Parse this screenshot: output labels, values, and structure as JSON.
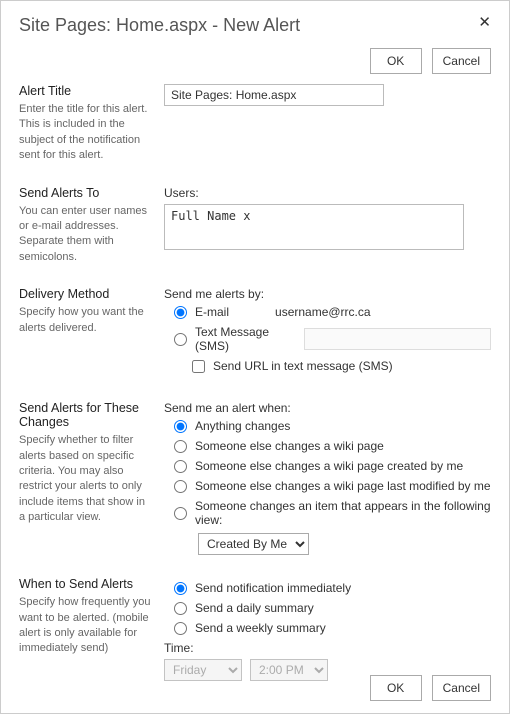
{
  "dialog": {
    "title": "Site Pages: Home.aspx - New Alert",
    "close": "✕"
  },
  "buttons": {
    "ok": "OK",
    "cancel": "Cancel"
  },
  "alertTitle": {
    "heading": "Alert Title",
    "desc": "Enter the title for this alert. This is included in the subject of the notification sent for this alert.",
    "value": "Site Pages: Home.aspx"
  },
  "sendTo": {
    "heading": "Send Alerts To",
    "desc": "You can enter user names or e-mail addresses. Separate them with semicolons.",
    "label": "Users:",
    "value": "Full Name x"
  },
  "delivery": {
    "heading": "Delivery Method",
    "desc": "Specify how you want the alerts delivered.",
    "label": "Send me alerts by:",
    "emailOpt": "E-mail",
    "emailValue": "username@rrc.ca",
    "smsOpt": "Text Message (SMS)",
    "smsUrl": "Send URL in text message (SMS)"
  },
  "changes": {
    "heading": "Send Alerts for These Changes",
    "desc": "Specify whether to filter alerts based on specific criteria. You may also restrict your alerts to only include items that show in a particular view.",
    "label": "Send me an alert when:",
    "opt1": "Anything changes",
    "opt2": "Someone else changes a wiki page",
    "opt3": "Someone else changes a wiki page created by me",
    "opt4": "Someone else changes a wiki page last modified by me",
    "opt5": "Someone changes an item that appears in the following view:",
    "viewSelected": "Created By Me"
  },
  "when": {
    "heading": "When to Send Alerts",
    "desc": "Specify how frequently you want to be alerted. (mobile alert is only available for immediately send)",
    "opt1": "Send notification immediately",
    "opt2": "Send a daily summary",
    "opt3": "Send a weekly summary",
    "timeLabel": "Time:",
    "day": "Friday",
    "hour": "2:00 PM"
  }
}
